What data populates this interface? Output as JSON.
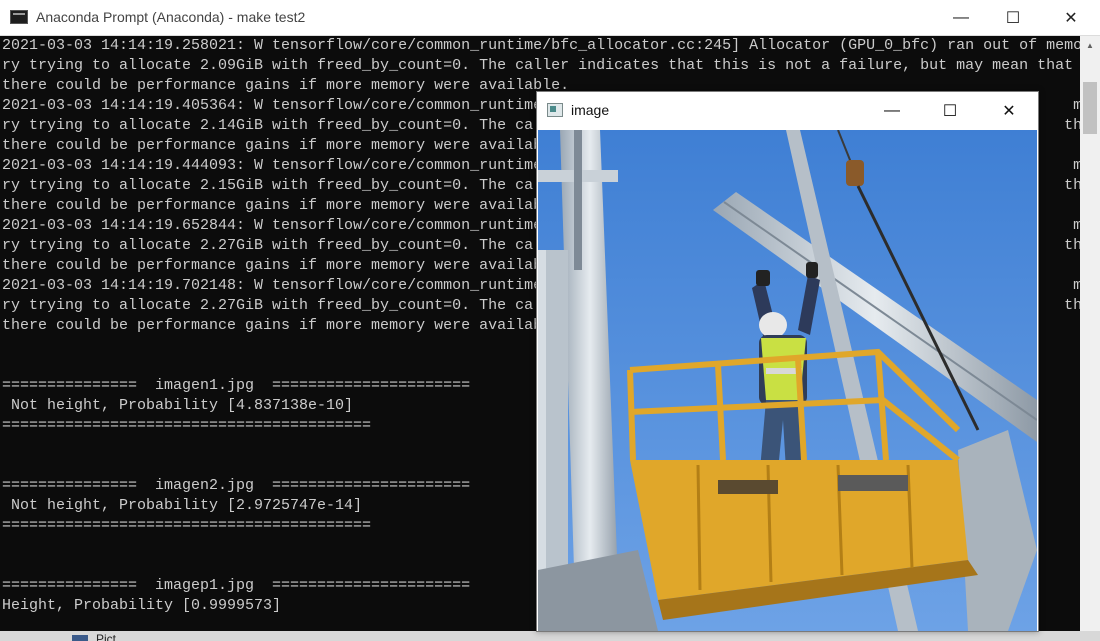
{
  "window": {
    "title": "Anaconda Prompt (Anaconda) - make  test2",
    "minimize_glyph": "—",
    "maximize_glyph": "☐",
    "close_glyph": "✕"
  },
  "console": {
    "lines": [
      "2021-03-03 14:14:19.258021: W tensorflow/core/common_runtime/bfc_allocator.cc:245] Allocator (GPU_0_bfc) ran out of memo",
      "ry trying to allocate 2.09GiB with freed_by_count=0. The caller indicates that this is not a failure, but may mean that",
      "there could be performance gains if more memory were available.",
      "2021-03-03 14:14:19.405364: W tensorflow/core/common_runtime                                                           memo",
      "ry trying to allocate 2.14GiB with freed_by_count=0. The ca                                                           that",
      "there could be performance gains if more memory were availab",
      "2021-03-03 14:14:19.444093: W tensorflow/core/common_runtime                                                           memo",
      "ry trying to allocate 2.15GiB with freed_by_count=0. The ca                                                           that",
      "there could be performance gains if more memory were availab",
      "2021-03-03 14:14:19.652844: W tensorflow/core/common_runtime                                                           memo",
      "ry trying to allocate 2.27GiB with freed_by_count=0. The ca                                                           that",
      "there could be performance gains if more memory were availab",
      "2021-03-03 14:14:19.702148: W tensorflow/core/common_runtime                                                           memo",
      "ry trying to allocate 2.27GiB with freed_by_count=0. The ca                                                           that",
      "there could be performance gains if more memory were availab",
      "",
      "",
      "===============  imagen1.jpg  ======================",
      " Not height, Probability [4.837138e-10]",
      "=========================================",
      "",
      "",
      "===============  imagen2.jpg  ======================",
      " Not height, Probability [2.9725747e-14]",
      "=========================================",
      "",
      "",
      "===============  imagep1.jpg  ======================",
      "Height, Probability [0.9999573]"
    ]
  },
  "image_window": {
    "title": "image",
    "minimize_glyph": "—",
    "maximize_glyph": "☐",
    "close_glyph": "✕"
  },
  "scrollbar": {
    "up_glyph": "▲"
  },
  "taskbar": {
    "item_text": "Pict"
  },
  "colors": {
    "console_bg": "#0c0c0c",
    "console_fg": "#cccccc",
    "sky": "#4a86d8",
    "platform_yellow": "#e0a72a"
  }
}
